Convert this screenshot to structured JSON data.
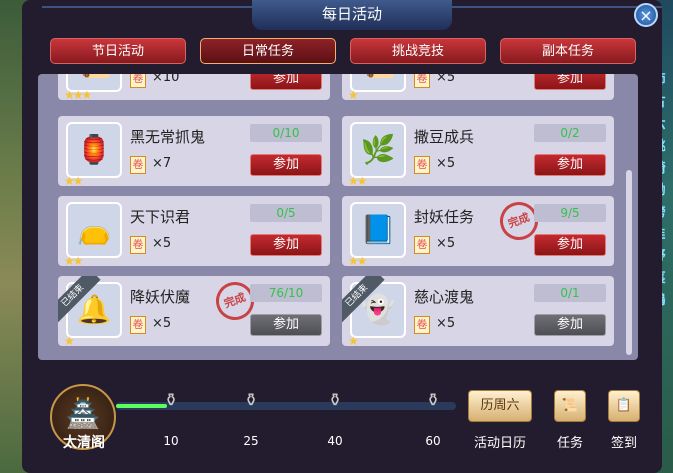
{
  "window": {
    "title": "每日活动",
    "close_glyph": "×"
  },
  "tabs": [
    {
      "label": "节日活动",
      "active": false
    },
    {
      "label": "日常任务",
      "active": true
    },
    {
      "label": "挑战竞技",
      "active": false
    },
    {
      "label": "副本任务",
      "active": false
    }
  ],
  "cards": [
    {
      "name": "",
      "progress": "",
      "reward": "×10",
      "button": "参加",
      "button_enabled": true,
      "stars": 3,
      "icon": "task-icon",
      "finished_ribbon": "",
      "stamp": ""
    },
    {
      "name": "",
      "progress": "",
      "reward": "×5",
      "button": "参加",
      "button_enabled": true,
      "stars": 1,
      "icon": "task-icon",
      "finished_ribbon": "",
      "stamp": ""
    },
    {
      "name": "黑无常抓鬼",
      "progress": "0/10",
      "reward": "×7",
      "button": "参加",
      "button_enabled": true,
      "stars": 2,
      "icon": "ghost-scroll-icon",
      "finished_ribbon": "",
      "stamp": ""
    },
    {
      "name": "撒豆成兵",
      "progress": "0/2",
      "reward": "×5",
      "button": "参加",
      "button_enabled": true,
      "stars": 2,
      "icon": "beans-icon",
      "finished_ribbon": "",
      "stamp": ""
    },
    {
      "name": "天下识君",
      "progress": "0/5",
      "reward": "×5",
      "button": "参加",
      "button_enabled": true,
      "stars": 2,
      "icon": "pouch-icon",
      "finished_ribbon": "",
      "stamp": ""
    },
    {
      "name": "封妖任务",
      "progress": "9/5",
      "reward": "×5",
      "button": "参加",
      "button_enabled": true,
      "stars": 2,
      "icon": "book-icon",
      "finished_ribbon": "",
      "stamp": "完成"
    },
    {
      "name": "降妖伏魔",
      "progress": "76/10",
      "reward": "×5",
      "button": "参加",
      "button_enabled": false,
      "stars": 1,
      "icon": "bell-icon",
      "finished_ribbon": "已结束",
      "stamp": "完成"
    },
    {
      "name": "慈心渡鬼",
      "progress": "0/1",
      "reward": "×5",
      "button": "参加",
      "button_enabled": false,
      "stars": 1,
      "icon": "spirit-icon",
      "finished_ribbon": "已结束",
      "stamp": ""
    }
  ],
  "bottom": {
    "pavilion_label": "太清阁",
    "activity_fill_fraction": 0.15,
    "milestones": [
      "10",
      "25",
      "40",
      "60"
    ],
    "calendar_day": "周六",
    "calendar_badge": "历",
    "calendar_label": "活动日历",
    "task_label": "任务",
    "signin_label": "签到"
  },
  "side_text": [
    "師",
    "古",
    "六",
    "跳",
    "騎",
    "鋤",
    "跨",
    "韭",
    "野",
    "萇",
    "鷄"
  ]
}
